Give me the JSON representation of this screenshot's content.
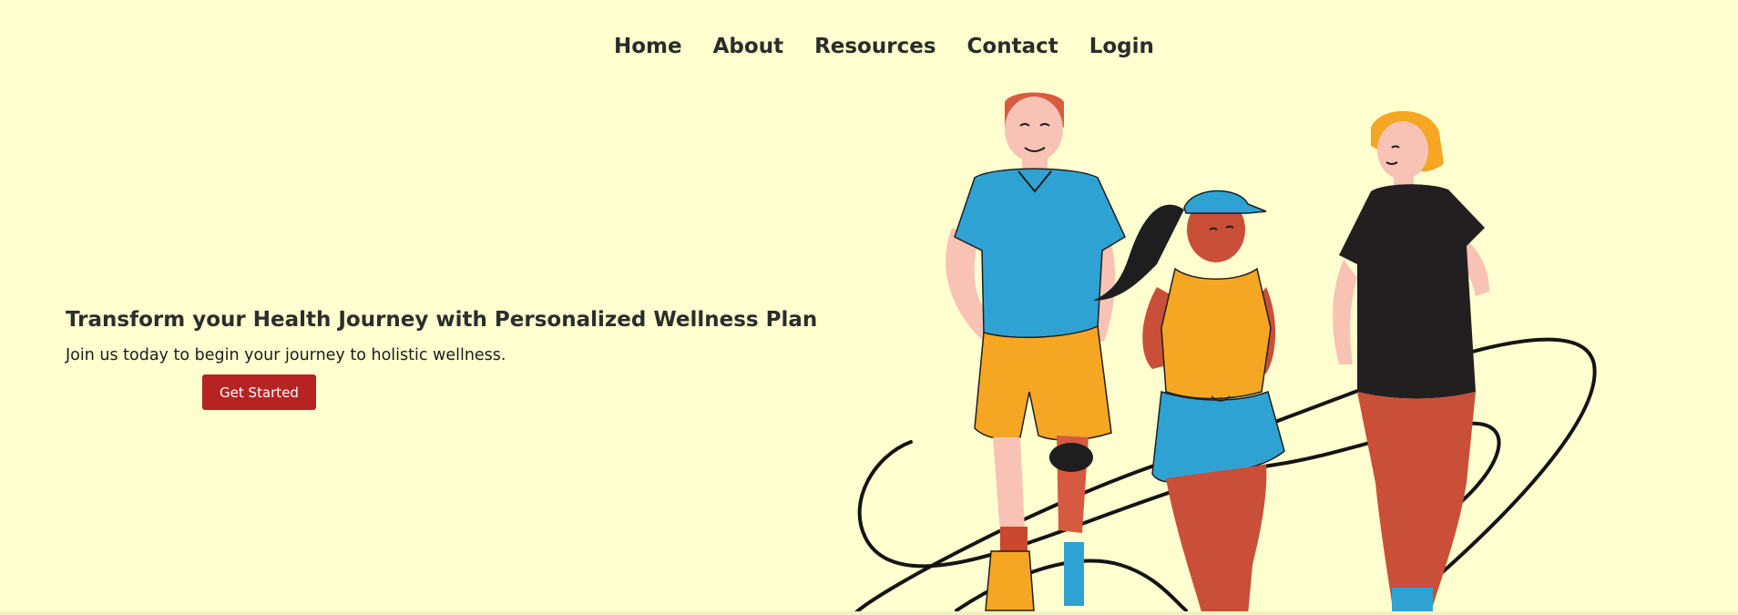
{
  "nav": {
    "items": [
      {
        "label": "Home"
      },
      {
        "label": "About"
      },
      {
        "label": "Resources"
      },
      {
        "label": "Contact"
      },
      {
        "label": "Login"
      }
    ]
  },
  "hero": {
    "title": "Transform your Health Journey with Personalized Wellness Plan",
    "subtitle": "Join us today to begin your journey to holistic wellness.",
    "cta_label": "Get Started"
  },
  "illustration": {
    "icon": "people-walking-illustration"
  },
  "colors": {
    "background": "#ffffd0",
    "accent": "#b72222",
    "text": "#2b2b2b"
  }
}
